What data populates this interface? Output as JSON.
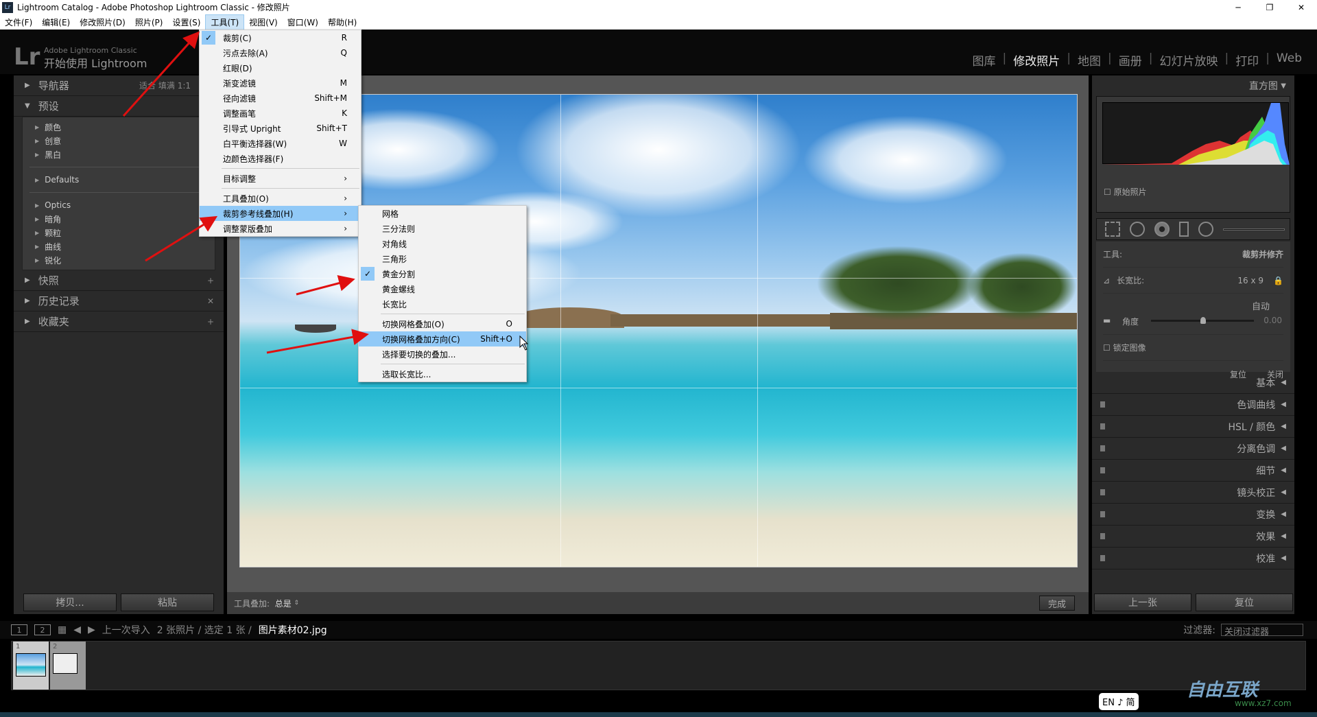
{
  "window": {
    "title": "Lightroom Catalog - Adobe Photoshop Lightroom Classic - 修改照片",
    "app_icon": "Lr",
    "controls": [
      "─",
      "❐",
      "✕"
    ]
  },
  "menubar": [
    "文件(F)",
    "编辑(E)",
    "修改照片(D)",
    "照片(P)",
    "设置(S)",
    "工具(T)",
    "视图(V)",
    "窗口(W)",
    "帮助(H)"
  ],
  "header": {
    "logo": "Lr",
    "brand": "Adobe Lightroom Classic",
    "subtitle": "开始使用 Lightroom",
    "modules": [
      "图库",
      "修改照片",
      "地图",
      "画册",
      "幻灯片放映",
      "打印",
      "Web"
    ],
    "current_module": "修改照片"
  },
  "left_panel": {
    "navigator": {
      "label": "导航器",
      "options": [
        "适合",
        "填满",
        "1:1"
      ]
    },
    "presets": {
      "label": "预设",
      "group1": [
        "颜色",
        "创意",
        "黑白"
      ],
      "group2": [
        "Defaults"
      ],
      "group3": [
        "Optics",
        "暗角",
        "颗粒",
        "曲线",
        "锐化"
      ]
    },
    "snapshots": "快照",
    "history": "历史记录",
    "collections": "收藏夹",
    "copy": "拷贝...",
    "paste": "粘贴"
  },
  "tools_menu": {
    "items": [
      {
        "label": "裁剪(C)",
        "shortcut": "R",
        "checked": true
      },
      {
        "label": "污点去除(A)",
        "shortcut": "Q"
      },
      {
        "label": "红眼(D)",
        "shortcut": ""
      },
      {
        "label": "渐变滤镜",
        "shortcut": "M"
      },
      {
        "label": "径向滤镜",
        "shortcut": "Shift+M"
      },
      {
        "label": "调整画笔",
        "shortcut": "K"
      },
      {
        "label": "引导式 Upright",
        "shortcut": "Shift+T"
      },
      {
        "label": "白平衡选择器(W)",
        "shortcut": "W"
      },
      {
        "label": "边颜色选择器(F)",
        "shortcut": ""
      }
    ],
    "target": "目标调整",
    "tool_overlay": "工具叠加(O)",
    "crop_guide": "裁剪参考线叠加(H)",
    "mask_overlay": "调整蒙版叠加",
    "arrow": "›"
  },
  "crop_submenu": {
    "items": [
      "网格",
      "三分法则",
      "对角线",
      "三角形",
      "黄金分割",
      "黄金螺线",
      "长宽比"
    ],
    "checked": "黄金分割",
    "toggle": "切换网格叠加(O)",
    "toggle_shortcut": "O",
    "cycle": "切换网格叠加方向(C)",
    "cycle_shortcut": "Shift+O",
    "choose": "选择要切换的叠加...",
    "aspect": "选取长宽比..."
  },
  "toolbar": {
    "label": "工具叠加:",
    "value": "总是",
    "done": "完成"
  },
  "right_panel": {
    "histogram": "直方图",
    "original": "原始照片",
    "tool_label": "工具:",
    "tool_name": "裁剪并修齐",
    "aspect_label": "长宽比:",
    "aspect_value": "16 x 9",
    "auto": "自动",
    "angle_label": "角度",
    "angle_value": "0.00",
    "lock_image": "锁定图像",
    "reset": "复位",
    "close": "关闭",
    "sections": [
      "基本",
      "色调曲线",
      "HSL / 颜色",
      "分离色调",
      "细节",
      "镜头校正",
      "变换",
      "效果",
      "校准"
    ],
    "prev": "上一张",
    "reset_btn": "复位"
  },
  "filmstrip": {
    "view1": "1",
    "view2": "2",
    "source": "上一次导入",
    "count": "2 张照片 / 选定 1 张 /",
    "filename": "图片素材02.jpg",
    "filter_label": "过滤器:",
    "filter_value": "关闭过滤器",
    "thumbs": [
      "1",
      "2"
    ]
  },
  "ime": "EN ♪ 简",
  "watermark": {
    "brand": "自由互联",
    "url": "www.xz7.com"
  },
  "colors": {
    "menu_highlight": "#91c9f7",
    "arrow": "#e01010"
  }
}
